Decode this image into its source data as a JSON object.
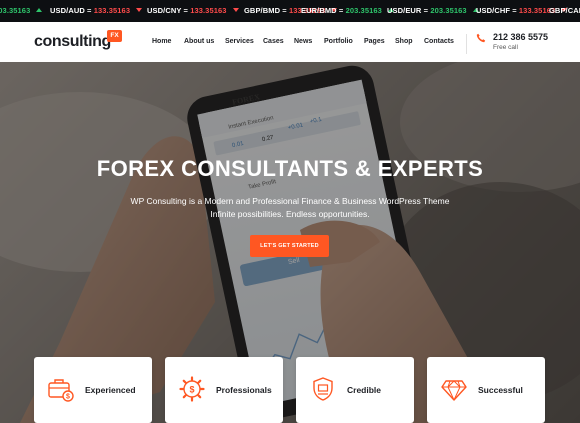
{
  "ticker": [
    {
      "pair": "",
      "value": "203.35163",
      "dir": "up"
    },
    {
      "pair": "USD/AUD",
      "value": "133.35163",
      "dir": "down"
    },
    {
      "pair": "USD/CNY",
      "value": "133.35163",
      "dir": "down"
    },
    {
      "pair": "GBP/BMD",
      "value": "133.35163",
      "dir": "down"
    },
    {
      "pair": "EUR/BMD",
      "value": "203.35163",
      "dir": "up"
    },
    {
      "pair": "USD/EUR",
      "value": "203.35163",
      "dir": "up"
    },
    {
      "pair": "USD/CHF",
      "value": "133.35163",
      "dir": "down"
    },
    {
      "pair": "GBP/CAD",
      "value": "",
      "dir": "down"
    }
  ],
  "header": {
    "logo": "consulting",
    "logo_badge": "FX",
    "nav": [
      "Home",
      "About us",
      "Services",
      "Cases",
      "News",
      "Portfolio",
      "Pages",
      "Shop",
      "Contacts"
    ],
    "phone": "212 386 5575",
    "phone_caption": "Free call",
    "phone_icon": "phone-icon"
  },
  "hero": {
    "title": "FOREX CONSULTANTS & EXPERTS",
    "subtitle_line1": "WP Consulting is a Modern and Professional Finance & Business WordPress Theme",
    "subtitle_line2": "Infinite possibilities. Endless opportunities.",
    "cta": "LET'S GET STARTED",
    "phone_screen": {
      "brand": "FOREX",
      "mode": "Instant Execution",
      "values": [
        "0.01",
        "0.27",
        "+0.01",
        "+0.1"
      ],
      "take_profit": "Take Profit",
      "sell": "Sell"
    }
  },
  "features": [
    {
      "label": "Experienced",
      "icon": "briefcase-coins-icon"
    },
    {
      "label": "Professionals",
      "icon": "gear-dollar-icon"
    },
    {
      "label": "Credible",
      "icon": "shield-badge-icon"
    },
    {
      "label": "Successful",
      "icon": "diamond-icon"
    }
  ],
  "colors": {
    "accent": "#ff5722",
    "ticker_bg": "#0d0f12",
    "up": "#2ec46b",
    "down": "#ff4b4b",
    "text": "#1d1f24"
  }
}
